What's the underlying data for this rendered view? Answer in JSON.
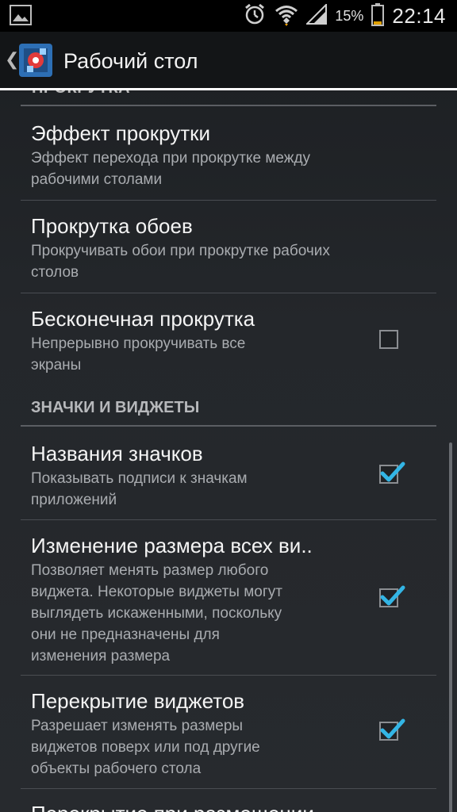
{
  "status_bar": {
    "battery_percent": "15%",
    "time": "22:14",
    "icons": [
      "image-notification-icon",
      "alarm-icon",
      "wifi-icon",
      "signal-icon",
      "battery-icon"
    ]
  },
  "action_bar": {
    "title": "Рабочий стол",
    "up_icon": "chevron-left-icon",
    "app_icon": "launcher-settings-icon"
  },
  "partial_header": "ПРОКРУТКА",
  "preferences": [
    {
      "title": "Эффект прокрутки",
      "summary": [
        "Эффект перехода при прокрутке между",
        "рабочими столами"
      ]
    },
    {
      "title": "Прокрутка обоев",
      "summary": [
        "Прокручивать обои при прокрутке рабочих",
        "столов"
      ]
    },
    {
      "title": "Бесконечная прокрутка",
      "summary": [
        "Непрерывно прокручивать все",
        "экраны"
      ],
      "checked": false
    }
  ],
  "category_header": "ЗНАЧКИ И ВИДЖЕТЫ",
  "widget_preferences": [
    {
      "title": "Названия значков",
      "summary": [
        "Показывать подписи к значкам",
        "приложений"
      ],
      "checked": true
    },
    {
      "title": "Изменение размера всех ви..",
      "summary": [
        "Позволяет менять размер любого",
        "виджета. Некоторые виджеты могут",
        "выглядеть искаженными, поскольку",
        "они не предназначены для",
        "изменения размера"
      ],
      "checked": true
    },
    {
      "title": "Перекрытие виджетов",
      "summary": [
        "Разрешает изменять размеры",
        "виджетов поверх или под другие",
        "объекты рабочего стола"
      ],
      "checked": true
    },
    {
      "title": "Перекрытие при размещении"
    }
  ],
  "colors": {
    "accent_check": "#33b5e5",
    "status_bar_bg": "#000000",
    "action_bar_bg": "#131517"
  }
}
